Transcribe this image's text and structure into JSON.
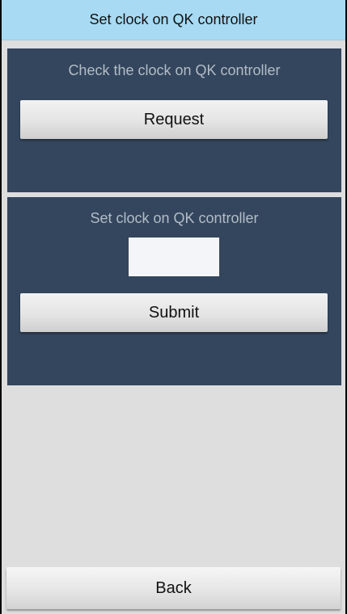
{
  "header": {
    "title": "Set clock on QK controller"
  },
  "check_section": {
    "label": "Check the clock on QK controller",
    "button_label": "Request"
  },
  "set_section": {
    "label": "Set clock on QK controller",
    "input_value": "",
    "button_label": "Submit"
  },
  "footer": {
    "back_label": "Back"
  },
  "colors": {
    "title_bar": "#a8daf3",
    "panel": "#34465d",
    "background": "#dedede",
    "panel_text": "#b3bcc7"
  }
}
